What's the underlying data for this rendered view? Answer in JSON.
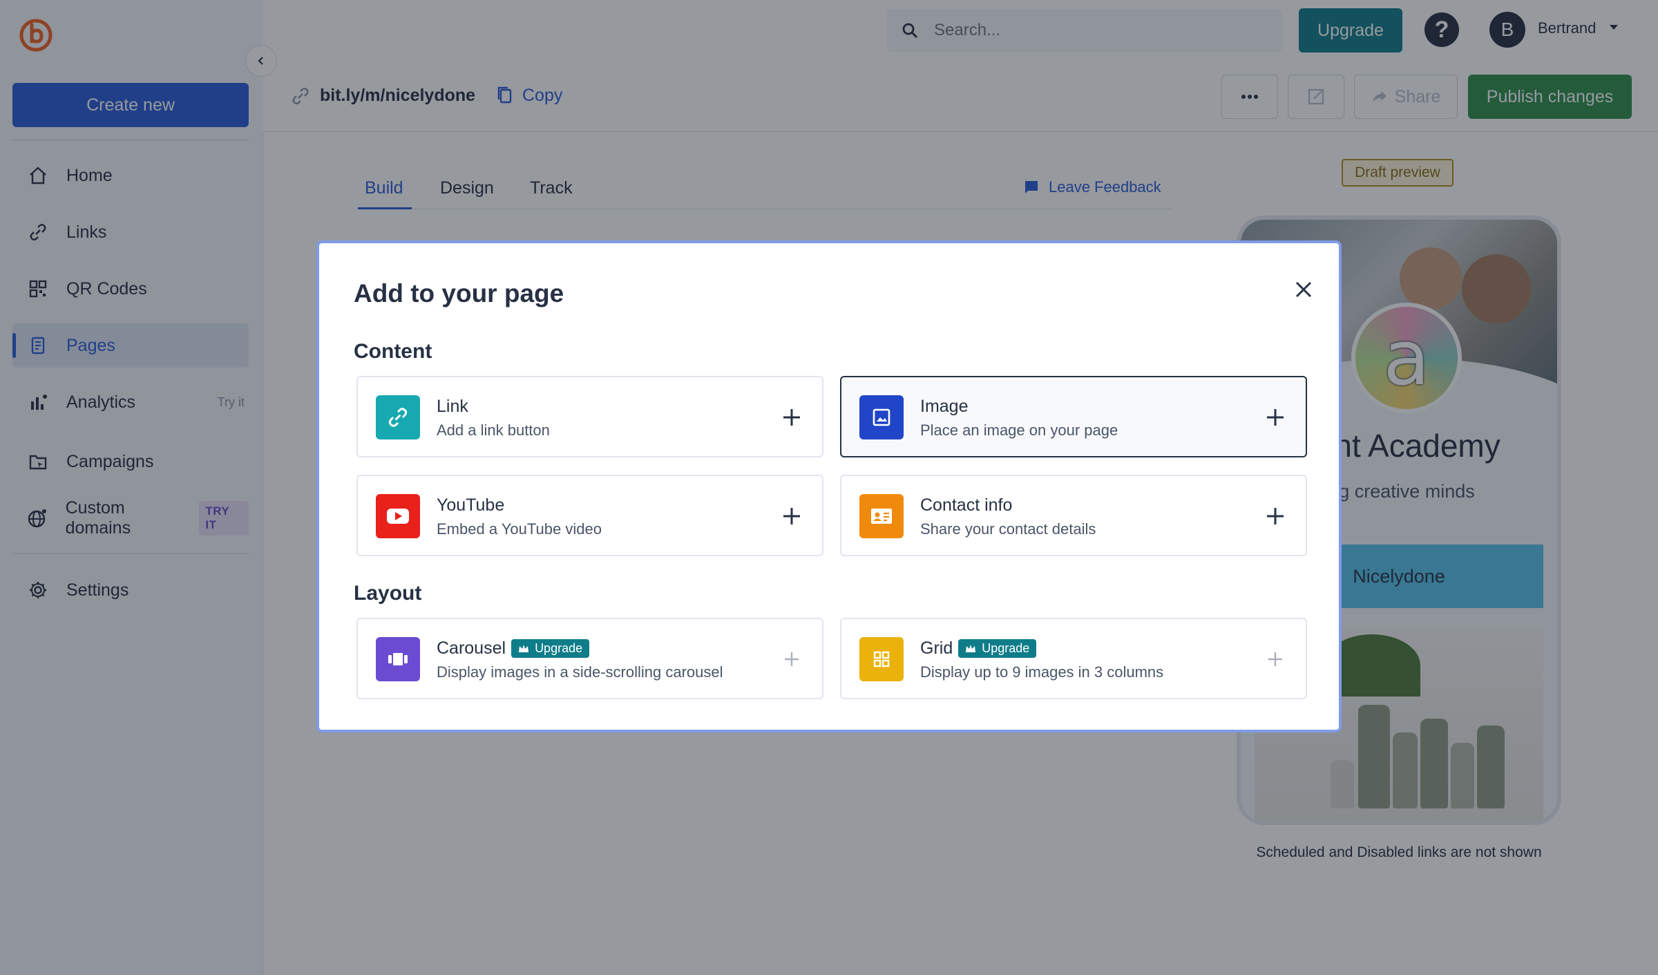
{
  "sidebar": {
    "create_label": "Create new",
    "items": [
      {
        "label": "Home",
        "icon": "home-icon"
      },
      {
        "label": "Links",
        "icon": "link-icon"
      },
      {
        "label": "QR Codes",
        "icon": "qr-code-icon"
      },
      {
        "label": "Pages",
        "icon": "pages-icon",
        "active": true
      },
      {
        "label": "Analytics",
        "icon": "analytics-icon",
        "tag": "Try it"
      },
      {
        "label": "Campaigns",
        "icon": "campaigns-icon"
      },
      {
        "label": "Custom domains",
        "icon": "globe-icon",
        "badge": "TRY IT"
      },
      {
        "label": "Settings",
        "icon": "gear-icon"
      }
    ]
  },
  "topbar": {
    "search_placeholder": "Search...",
    "upgrade_label": "Upgrade",
    "help_label": "?",
    "avatar_initial": "B",
    "username": "Bertrand"
  },
  "header": {
    "short_url": "bit.ly/m/nicelydone",
    "copy_label": "Copy",
    "share_label": "Share",
    "publish_label": "Publish changes"
  },
  "tabs": {
    "build": "Build",
    "design": "Design",
    "track": "Track",
    "feedback": "Leave Feedback"
  },
  "preview": {
    "draft_label": "Draft preview",
    "logo_letter": "a",
    "title": "nont Academy",
    "subtitle": "ing creative minds",
    "button_label": "Nicelydone",
    "note": "Scheduled and Disabled links are not shown"
  },
  "modal": {
    "title": "Add to your page",
    "content_section": "Content",
    "layout_section": "Layout",
    "upgrade_badge": "Upgrade",
    "content_items": [
      {
        "name": "Link",
        "desc": "Add a link button",
        "icon": "link-icon",
        "color": "#16a9b0"
      },
      {
        "name": "Image",
        "desc": "Place an image on your page",
        "icon": "image-icon",
        "color": "#2045c8"
      },
      {
        "name": "YouTube",
        "desc": "Embed a YouTube video",
        "icon": "youtube-icon",
        "color": "#e8211b"
      },
      {
        "name": "Contact info",
        "desc": "Share your contact details",
        "icon": "contact-card-icon",
        "color": "#f08a0c"
      }
    ],
    "layout_items": [
      {
        "name": "Carousel",
        "desc": "Display images in a side-scrolling carousel",
        "icon": "carousel-icon",
        "color": "#6b4bd1"
      },
      {
        "name": "Grid",
        "desc": "Display up to 9 images in 3 columns",
        "icon": "grid-icon",
        "color": "#eab20b"
      }
    ]
  }
}
